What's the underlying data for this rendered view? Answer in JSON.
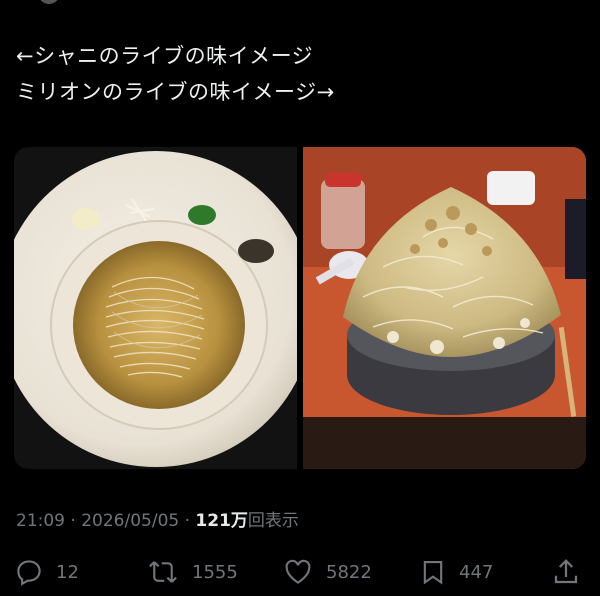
{
  "tweet": {
    "line1": "←シャニのライブの味イメージ",
    "line2": "ミリオンのライブの味イメージ→"
  },
  "media": {
    "left_photo": "shio-ramen-bowl",
    "right_photo": "jiro-style-ramen-bowl"
  },
  "meta": {
    "time": "21:09",
    "separator1": " · ",
    "date": "2026/05/05",
    "separator2": " · ",
    "views_count": "121万",
    "views_label": "回表示"
  },
  "actions": {
    "reply_count": "12",
    "retweet_count": "1555",
    "like_count": "5822",
    "bookmark_count": "447"
  },
  "icons": {
    "reply": "reply-icon",
    "retweet": "retweet-icon",
    "like": "heart-icon",
    "bookmark": "bookmark-icon",
    "share": "share-icon"
  },
  "colors": {
    "background": "#000000",
    "text": "#e7e9ea",
    "muted": "#71767b"
  }
}
